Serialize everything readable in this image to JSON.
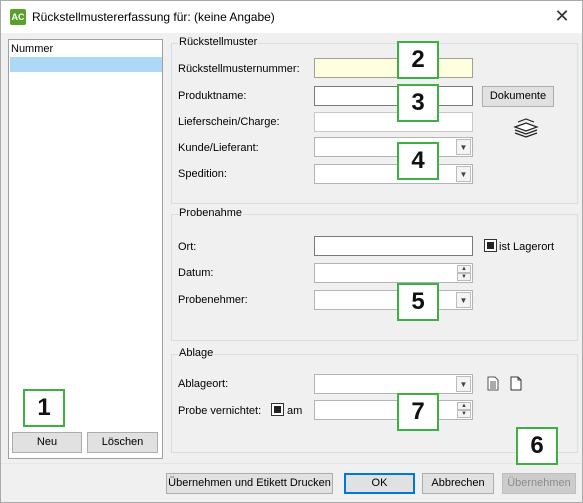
{
  "window": {
    "title": "Rückstellmustererfassung für: (keine Angabe)",
    "app_icon": "AC"
  },
  "list": {
    "column_header": "Nummer"
  },
  "list_buttons": {
    "new": "Neu",
    "delete": "Löschen"
  },
  "group_rueckstellmuster": {
    "title": "Rückstellmuster",
    "number_label": "Rückstellmusternummer:",
    "product_label": "Produktname:",
    "delivery_label": "Lieferschein/Charge:",
    "customer_label": "Kunde/Lieferant:",
    "shipping_label": "Spedition:",
    "documents_button": "Dokumente"
  },
  "group_probenahme": {
    "title": "Probenahme",
    "location_label": "Ort:",
    "is_warehouse_label": "ist Lagerort",
    "date_label": "Datum:",
    "sampler_label": "Probenehmer:"
  },
  "group_ablage": {
    "title": "Ablage",
    "storage_label": "Ablageort:",
    "destroyed_label": "Probe vernichtet:",
    "on_label": "am"
  },
  "footer": {
    "save_print": "Übernehmen und Etikett Drucken",
    "ok": "OK",
    "cancel": "Abbrechen",
    "apply": "Übernehmen"
  },
  "badges": [
    "1",
    "2",
    "3",
    "4",
    "5",
    "6",
    "7"
  ],
  "colors": {
    "badge_border": "#3cb043",
    "selection": "#add8f7",
    "required_field": "#ffffe0"
  }
}
